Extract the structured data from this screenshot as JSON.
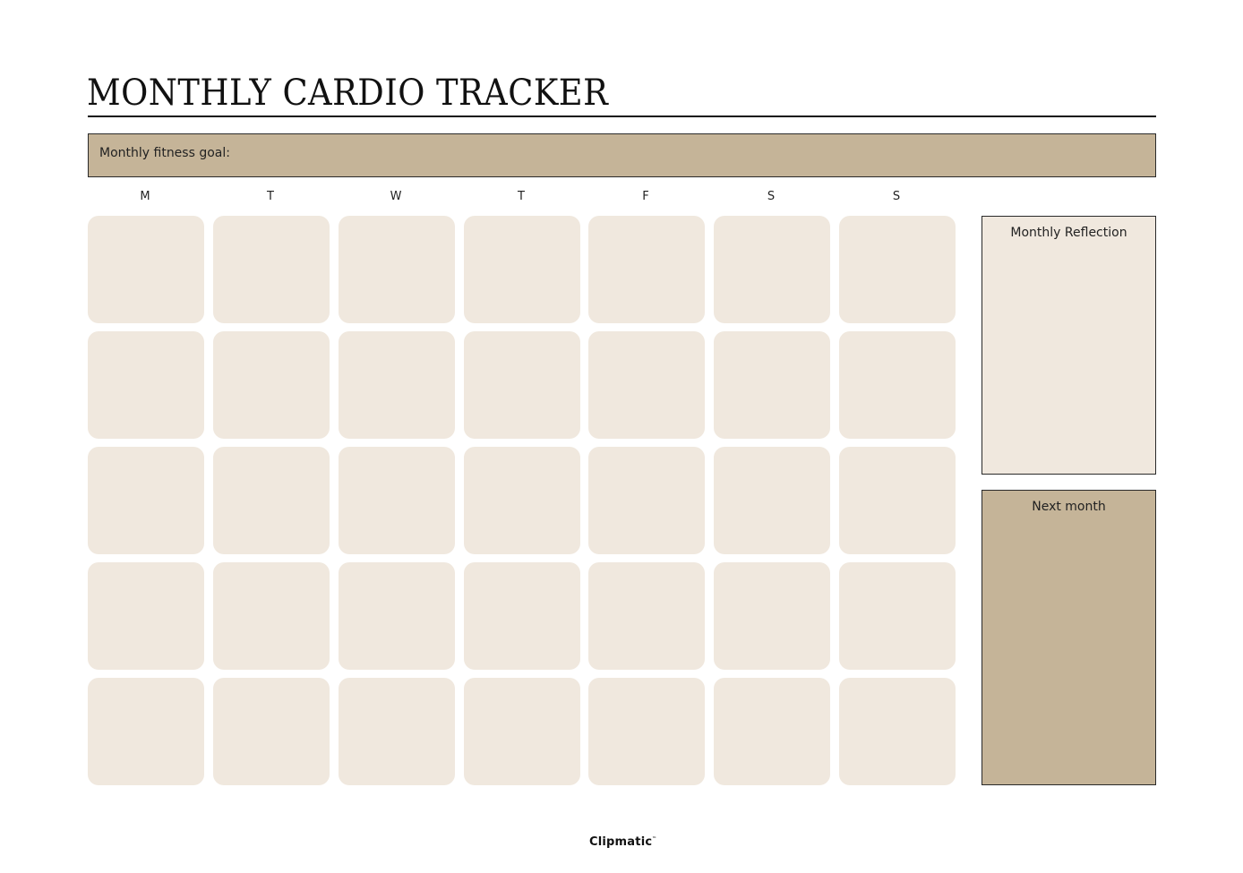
{
  "header": {
    "title": "MONTHLY CARDIO TRACKER"
  },
  "goal": {
    "label": "Monthly fitness goal:"
  },
  "calendar": {
    "days": [
      "M",
      "T",
      "W",
      "T",
      "F",
      "S",
      "S"
    ],
    "rows": 5,
    "columns": 7
  },
  "sidebar": {
    "reflection_title": "Monthly Reflection",
    "next_month_title": "Next month"
  },
  "footer": {
    "logo_text": "Clipmatic",
    "trademark": "™"
  },
  "colors": {
    "accent_tan": "#c5b498",
    "cell_beige": "#f0e8de",
    "border": "#2a2a2a"
  }
}
